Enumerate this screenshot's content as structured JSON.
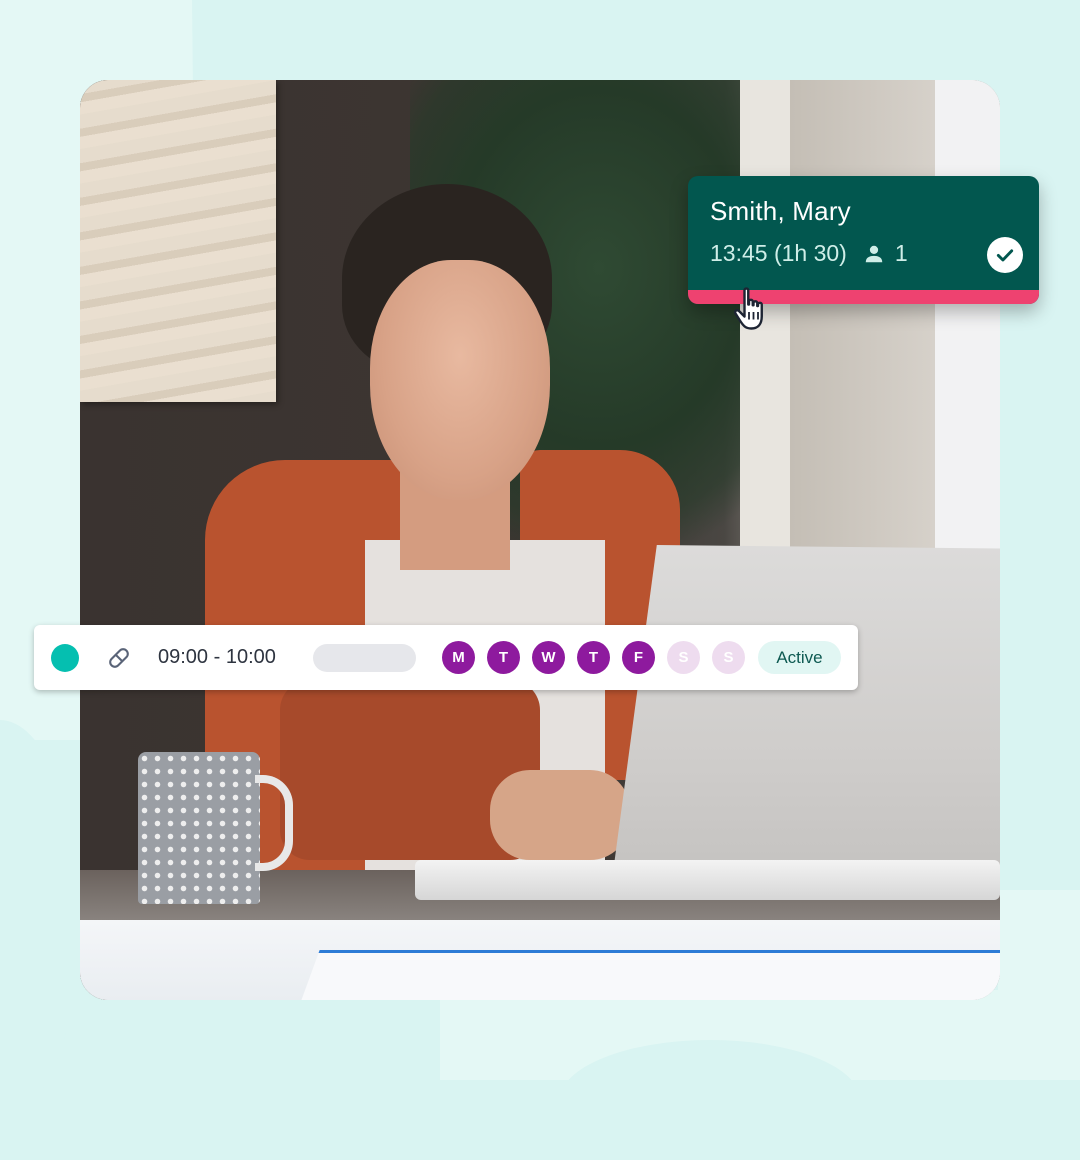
{
  "appointment_card": {
    "client_name": "Smith, Mary",
    "start_time_duration": "13:45 (1h 30)",
    "attendee_count": "1",
    "icons": {
      "attendee": "person-icon",
      "status": "check-circle-icon"
    },
    "colors": {
      "background": "#02574f",
      "accent": "#ee4270"
    }
  },
  "cursor": {
    "icon": "hand-pointer-cursor-icon"
  },
  "schedule_row": {
    "status_dot_color": "#05bfb0",
    "type_icon": "pill-icon",
    "time_range": "09:00 - 10:00",
    "days": [
      {
        "label": "M",
        "active": true
      },
      {
        "label": "T",
        "active": true
      },
      {
        "label": "W",
        "active": true
      },
      {
        "label": "T",
        "active": true
      },
      {
        "label": "F",
        "active": true
      },
      {
        "label": "S",
        "active": false
      },
      {
        "label": "S",
        "active": false
      }
    ],
    "status_badge": "Active",
    "colors": {
      "day_active": "#8e1a9e",
      "day_inactive": "#eedcef",
      "badge_bg": "#e1f6f3",
      "badge_text": "#0e5a52"
    }
  },
  "photo": {
    "description": "woman smiling while working on a laptop at a desk"
  }
}
